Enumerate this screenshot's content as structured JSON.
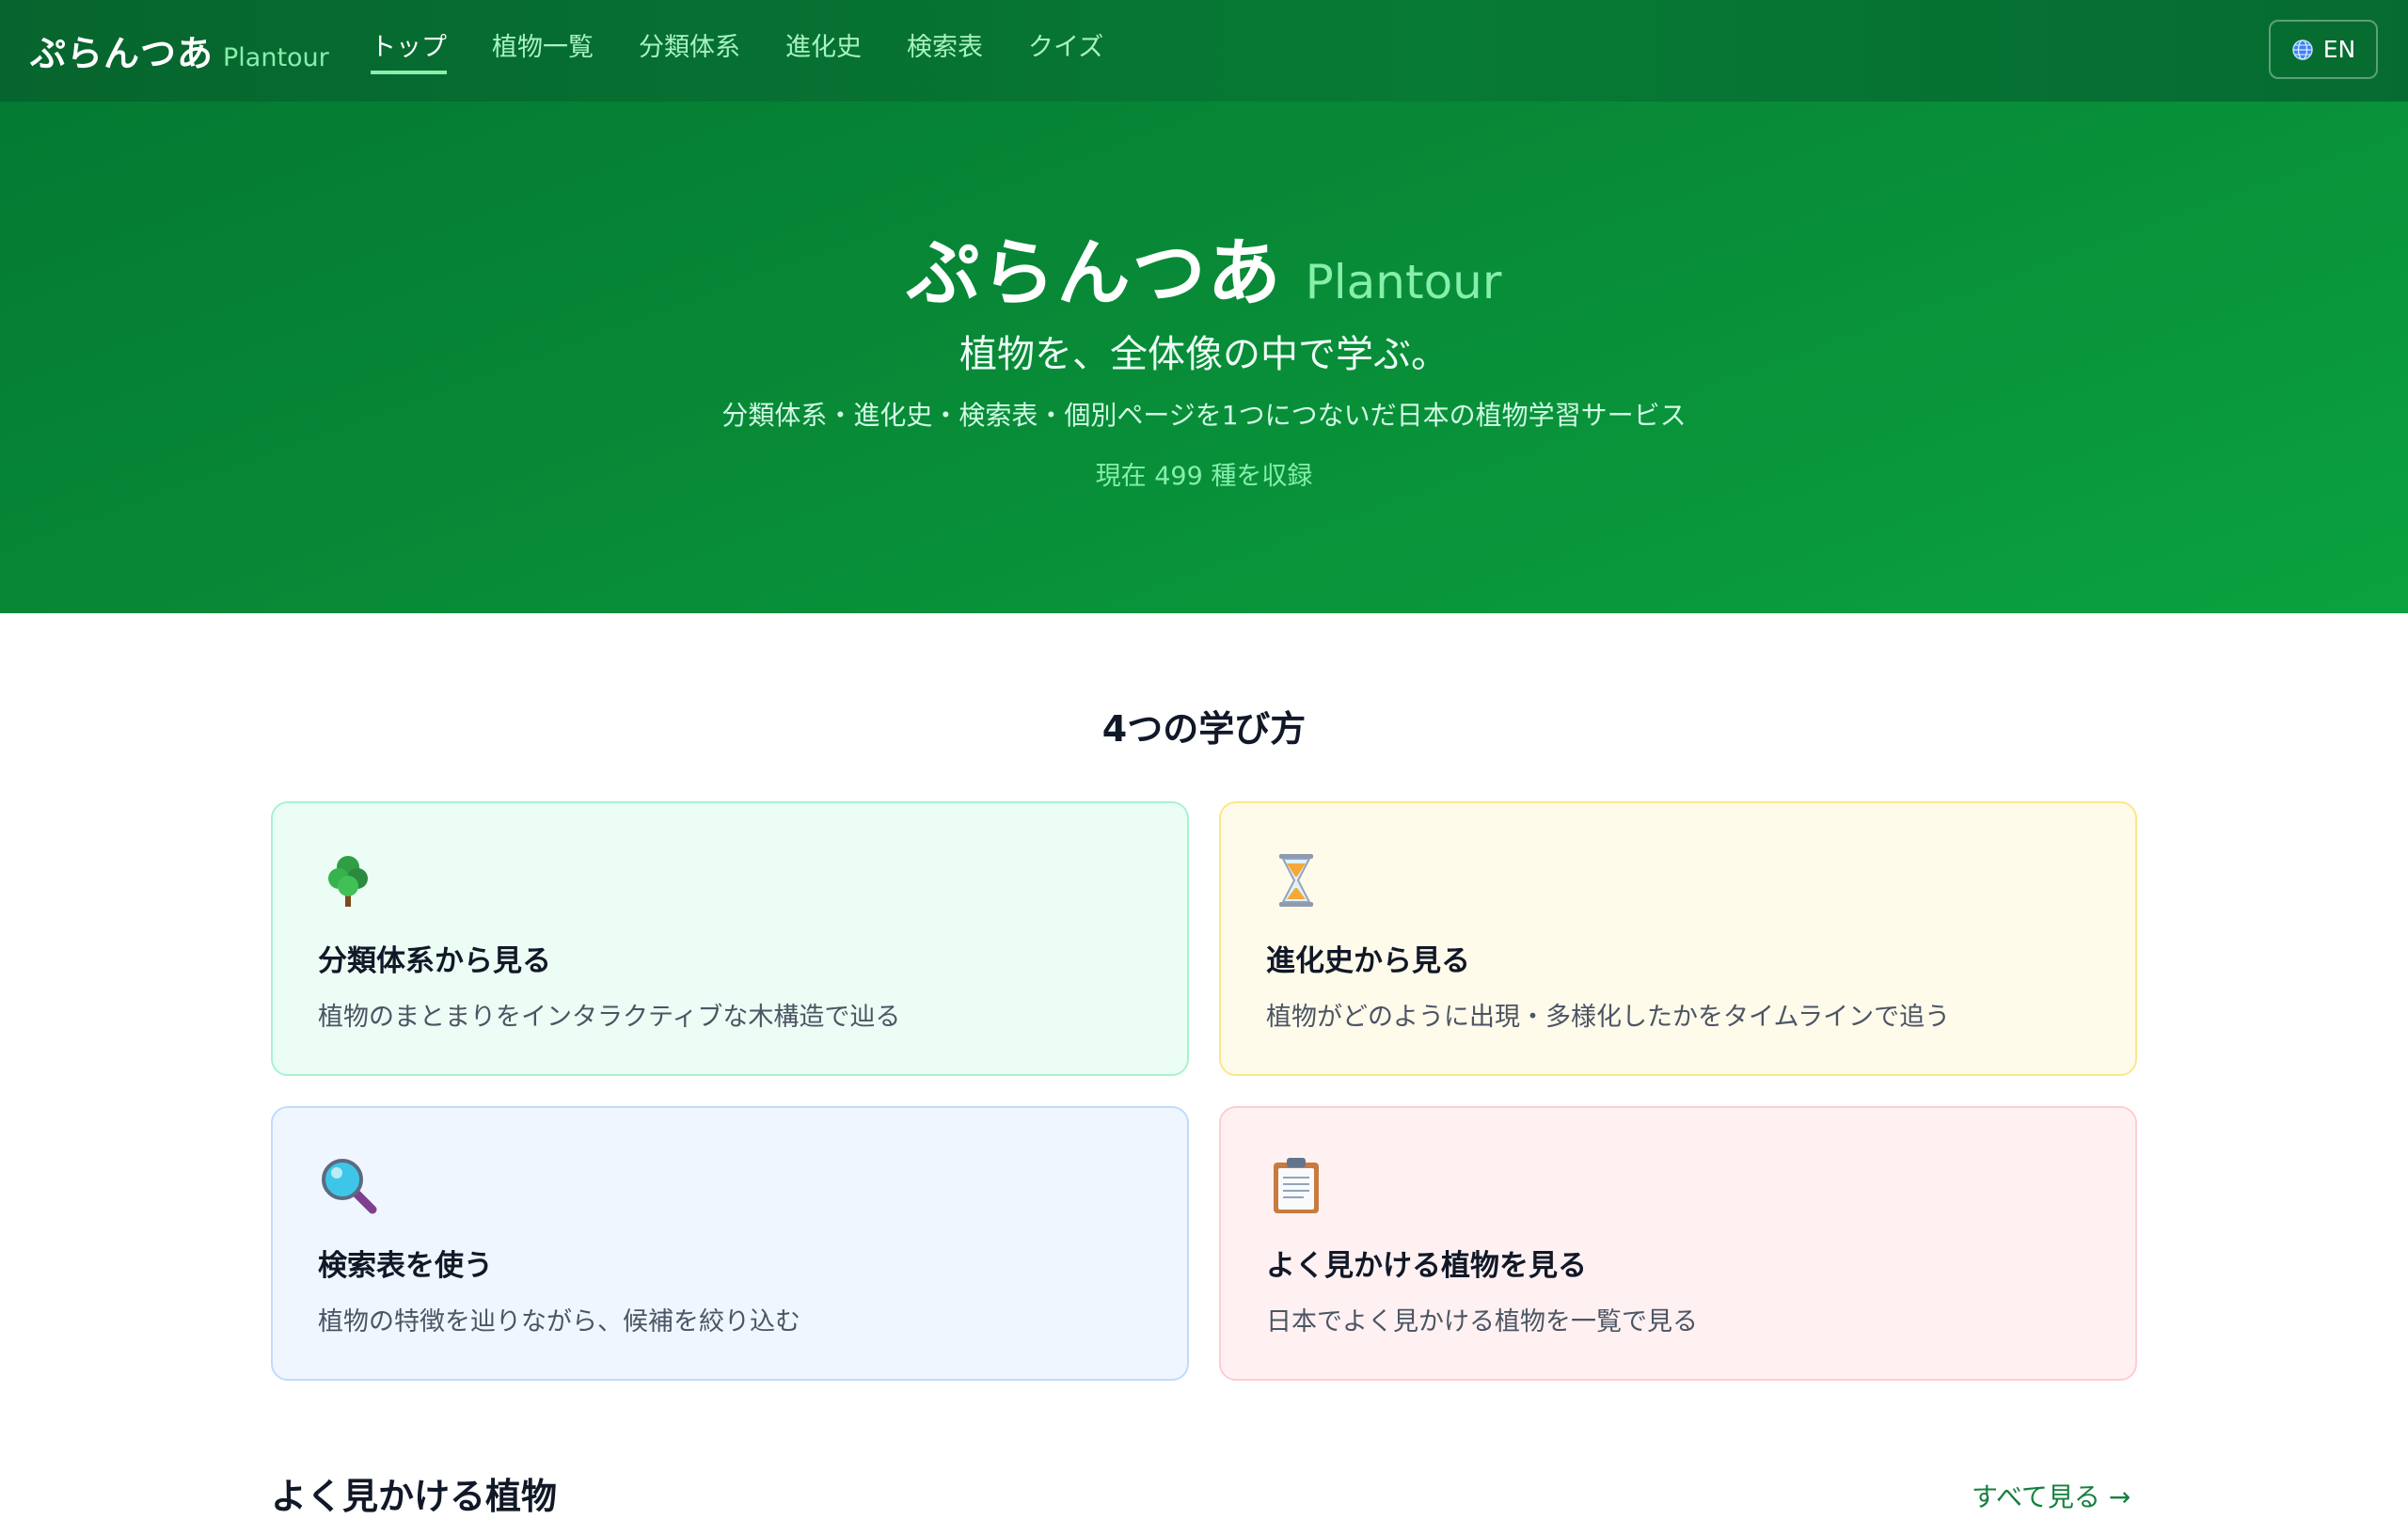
{
  "header": {
    "brand_ja": "ぷらんつあ",
    "brand_en": "Plantour",
    "nav": [
      {
        "label": "トップ",
        "active": true
      },
      {
        "label": "植物一覧"
      },
      {
        "label": "分類体系"
      },
      {
        "label": "進化史"
      },
      {
        "label": "検索表"
      },
      {
        "label": "クイズ"
      }
    ],
    "lang_button": "EN"
  },
  "hero": {
    "title_ja": "ぷらんつあ",
    "title_en": "Plantour",
    "tagline": "植物を、全体像の中で学ぶ。",
    "description": "分類体系・進化史・検索表・個別ページを1つにつないだ日本の植物学習サービス",
    "count": "現在 499 種を収録"
  },
  "section": {
    "title": "4つの学び方",
    "cards": [
      {
        "icon": "tree-icon",
        "title": "分類体系から見る",
        "desc": "植物のまとまりをインタラクティブな木構造で辿る"
      },
      {
        "icon": "hourglass-icon",
        "title": "進化史から見る",
        "desc": "植物がどのように出現・多様化したかをタイムラインで追う"
      },
      {
        "icon": "magnifier-icon",
        "title": "検索表を使う",
        "desc": "植物の特徴を辿りながら、候補を絞り込む"
      },
      {
        "icon": "clipboard-icon",
        "title": "よく見かける植物を見る",
        "desc": "日本でよく見かける植物を一覧で見る"
      }
    ]
  },
  "common": {
    "title": "よく見かける植物",
    "see_all": "すべて見る →"
  },
  "colors": {
    "header_bg": "#06652e",
    "hero_bg": "#088a37",
    "accent_light": "#86efac",
    "link": "#15803d"
  }
}
